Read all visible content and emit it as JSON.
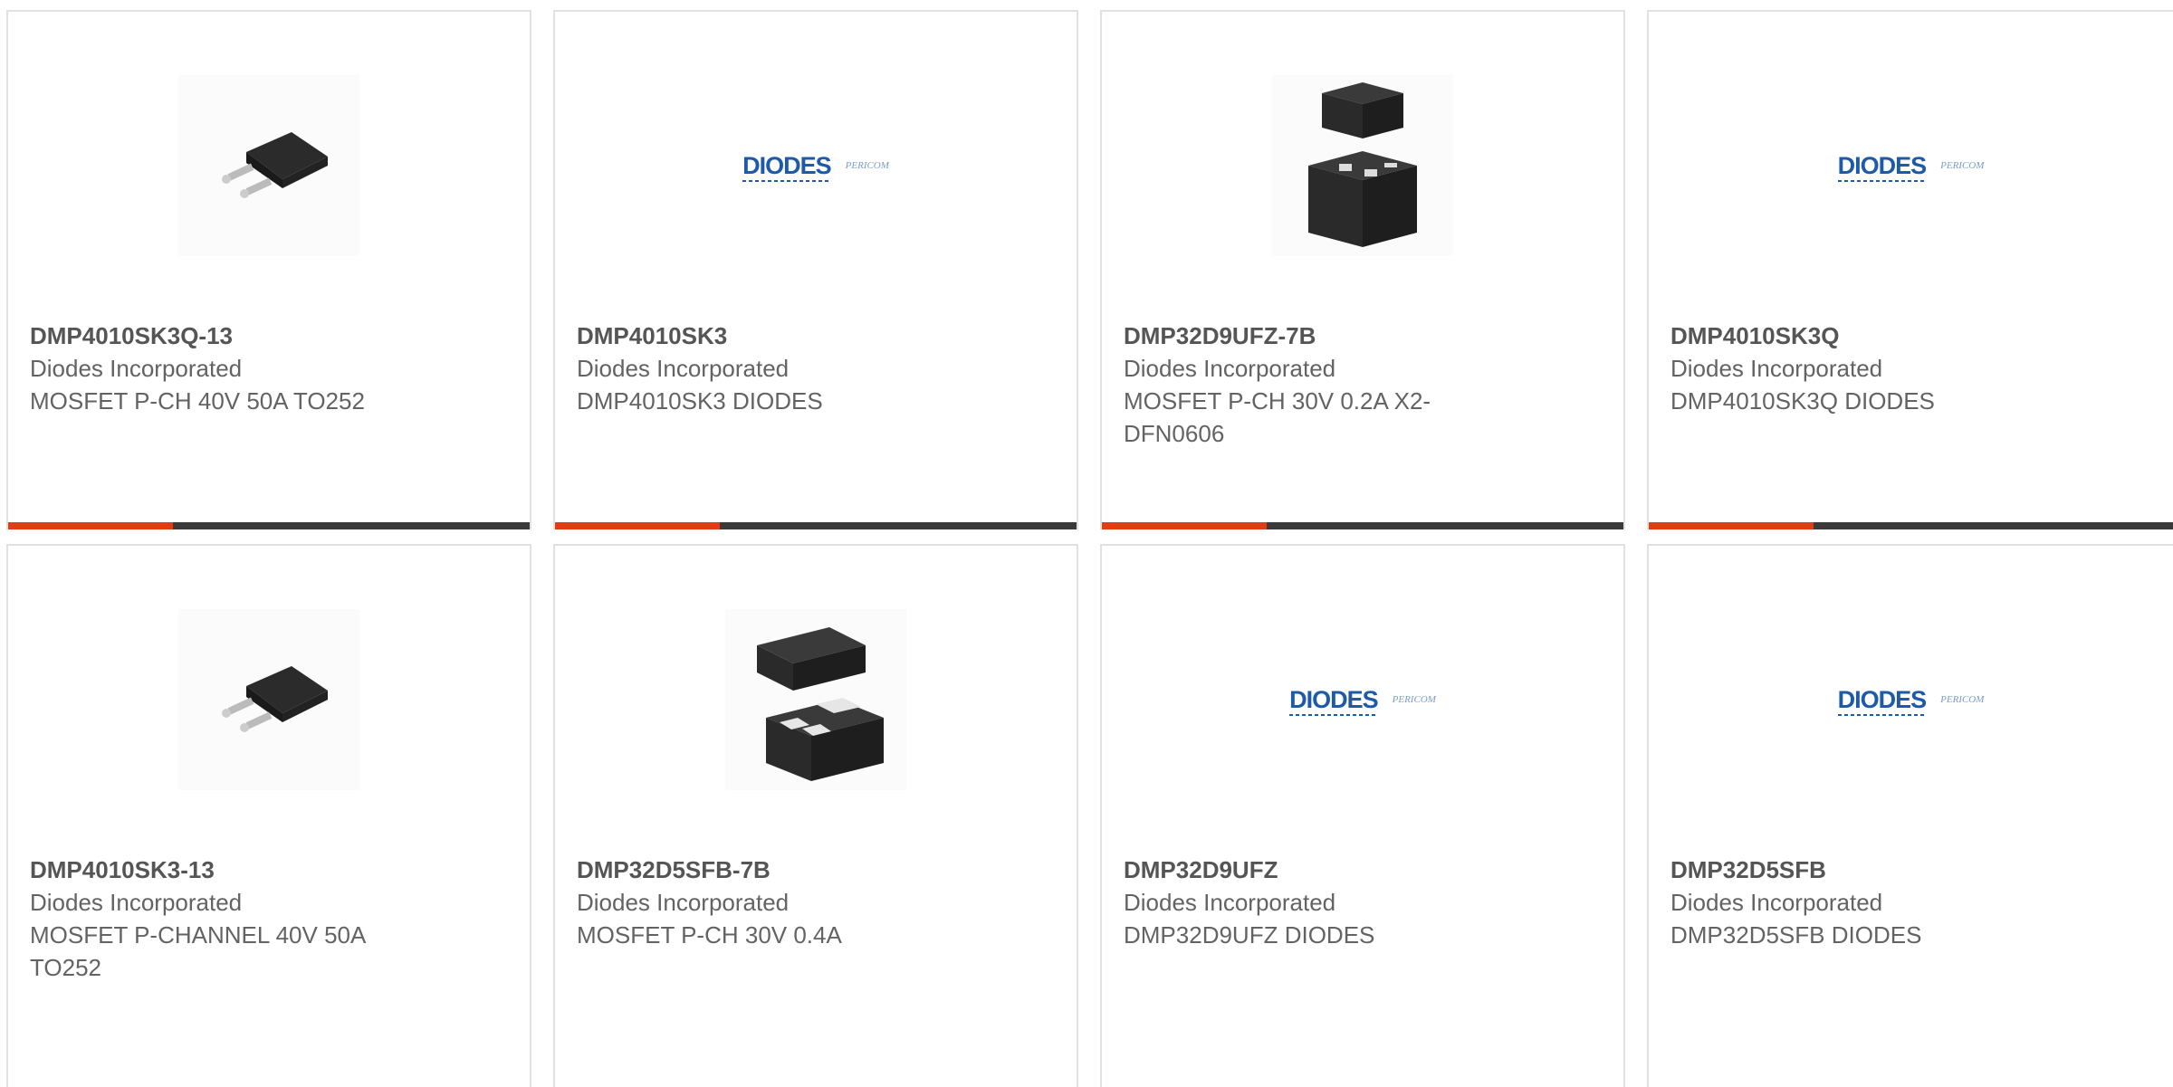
{
  "products": [
    {
      "part": "DMP4010SK3Q-13",
      "manufacturer": "Diodes Incorporated",
      "description": "MOSFET P-CH 40V 50A TO252",
      "image": "to252-package-photo"
    },
    {
      "part": "DMP4010SK3",
      "manufacturer": "Diodes Incorporated",
      "description": "DMP4010SK3 DIODES",
      "image": "diodes-pericom-logo"
    },
    {
      "part": "DMP32D9UFZ-7B",
      "manufacturer": "Diodes Incorporated",
      "description": "MOSFET P-CH 30V 0.2A X2-DFN0606",
      "image": "x2-dfn0606-package-photo"
    },
    {
      "part": "DMP4010SK3Q",
      "manufacturer": "Diodes Incorporated",
      "description": "DMP4010SK3Q DIODES",
      "image": "diodes-pericom-logo"
    },
    {
      "part": "DMP4010SK3-13",
      "manufacturer": "Diodes Incorporated",
      "description": "MOSFET P-CHANNEL 40V 50A TO252",
      "image": "to252-package-photo"
    },
    {
      "part": "DMP32D5SFB-7B",
      "manufacturer": "Diodes Incorporated",
      "description": "MOSFET P-CH 30V 0.4A",
      "image": "dfn-package-photo"
    },
    {
      "part": "DMP32D9UFZ",
      "manufacturer": "Diodes Incorporated",
      "description": "DMP32D9UFZ DIODES",
      "image": "diodes-pericom-logo"
    },
    {
      "part": "DMP32D5SFB",
      "manufacturer": "Diodes Incorporated",
      "description": "DMP32D5SFB DIODES",
      "image": "diodes-pericom-logo"
    }
  ],
  "logo": {
    "brand": "DIODES",
    "sub": "PERICOM"
  },
  "colors": {
    "accent": "#e03c16",
    "bar": "#3a3a3a",
    "text": "#636363",
    "logo_blue": "#1d5aa8"
  }
}
